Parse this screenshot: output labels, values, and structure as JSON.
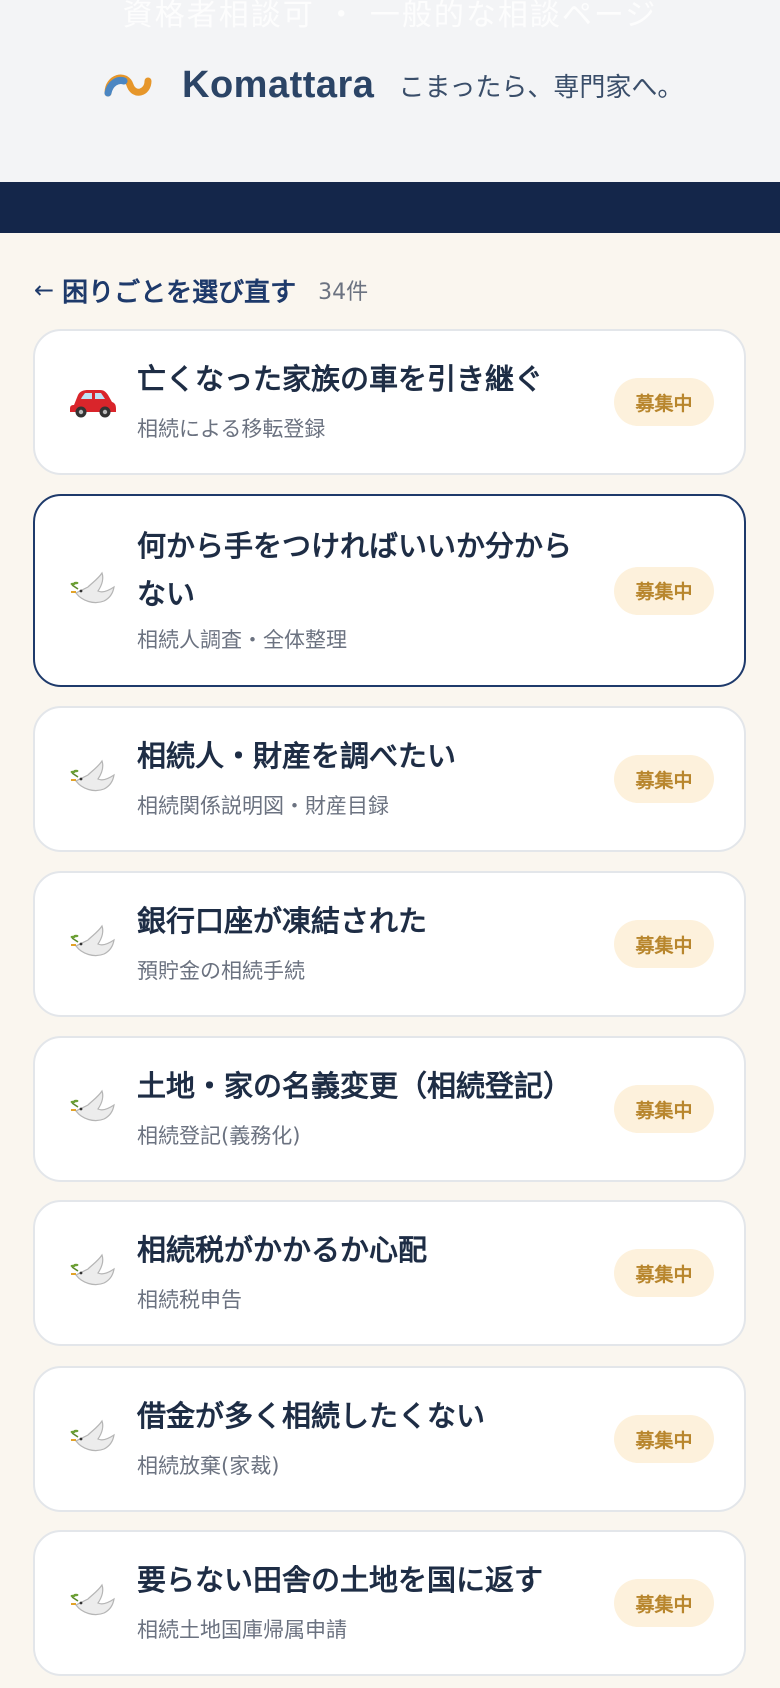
{
  "header": {
    "ghost_text": "資格者相談可 ・ 一般的な相談ページ",
    "brand": "Komattara",
    "tagline": "こまったら、専門家へ。"
  },
  "back": {
    "arrow": "←",
    "label": "困りごとを選び直す",
    "count": "34件"
  },
  "cards": [
    {
      "icon": "car-icon",
      "title": "亡くなった家族の車を引き継ぐ",
      "subtitle": "相続による移転登録",
      "badge": "募集中"
    },
    {
      "icon": "dove-icon",
      "title": "何から手をつければいいか分からない",
      "subtitle": "相続人調査・全体整理",
      "badge": "募集中"
    },
    {
      "icon": "dove-icon",
      "title": "相続人・財産を調べたい",
      "subtitle": "相続関係説明図・財産目録",
      "badge": "募集中"
    },
    {
      "icon": "dove-icon",
      "title": "銀行口座が凍結された",
      "subtitle": "預貯金の相続手続",
      "badge": "募集中"
    },
    {
      "icon": "dove-icon",
      "title": "土地・家の名義変更（相続登記）",
      "subtitle": "相続登記(義務化)",
      "badge": "募集中"
    },
    {
      "icon": "dove-icon",
      "title": "相続税がかかるか心配",
      "subtitle": "相続税申告",
      "badge": "募集中"
    },
    {
      "icon": "dove-icon",
      "title": "借金が多く相続したくない",
      "subtitle": "相続放棄(家裁)",
      "badge": "募集中"
    },
    {
      "icon": "dove-icon",
      "title": "要らない田舎の土地を国に返す",
      "subtitle": "相続土地国庫帰属申請",
      "badge": "募集中"
    }
  ],
  "colors": {
    "navy": "#14264a",
    "accent": "#1e3a6b",
    "badge_bg": "#fdf1dc",
    "badge_text": "#b8862d"
  }
}
